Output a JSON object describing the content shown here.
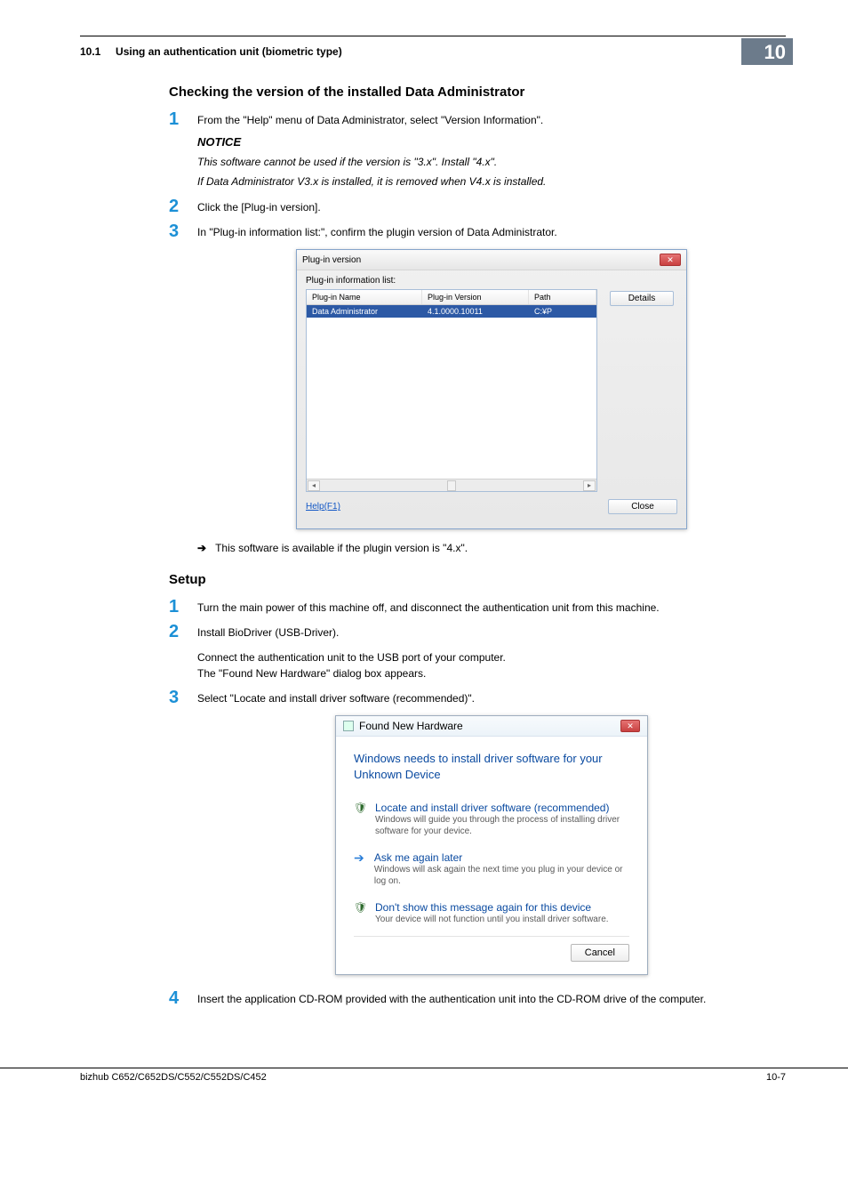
{
  "header": {
    "section_number": "10.1",
    "section_title": "Using an authentication unit (biometric type)",
    "chapter_number": "10"
  },
  "section_a": {
    "title": "Checking the version of the installed Data Administrator",
    "steps": {
      "s1": {
        "text": "From the \"Help\" menu of Data Administrator, select \"Version Information\".",
        "notice_label": "NOTICE",
        "notice_line1": "This software cannot be used if the version is \"3.x\". Install \"4.x\".",
        "notice_line2": "If Data Administrator V3.x is installed, it is removed when V4.x is installed."
      },
      "s2": {
        "text": "Click the [Plug-in version]."
      },
      "s3": {
        "text": "In \"Plug-in information list:\", confirm the plugin version of Data Administrator."
      }
    },
    "plugin_dialog": {
      "title": "Plug-in version",
      "list_label": "Plug-in information list:",
      "columns": {
        "name": "Plug-in Name",
        "version": "Plug-in Version",
        "path": "Path"
      },
      "row": {
        "name": "Data Administrator",
        "version": "4.1.0000.10011",
        "path": "C:¥P"
      },
      "details_button": "Details",
      "help_link": "Help(F1)",
      "close_button": "Close"
    },
    "note_arrow": "This software is available if the plugin version is \"4.x\"."
  },
  "section_b": {
    "title": "Setup",
    "steps": {
      "s1": {
        "text": "Turn the main power of this machine off, and disconnect the authentication unit from this machine."
      },
      "s2": {
        "text": "Install BioDriver (USB-Driver).",
        "extra1": "Connect the authentication unit to the USB port of your computer.",
        "extra2": "The \"Found New Hardware\" dialog box appears."
      },
      "s3": {
        "text": "Select \"Locate and install driver software (recommended)\"."
      },
      "s4": {
        "text": "Insert the application CD-ROM provided with the authentication unit into the CD-ROM drive of the computer."
      }
    },
    "fnh_dialog": {
      "title": "Found New Hardware",
      "heading": "Windows needs to install driver software for your Unknown Device",
      "opt1": {
        "title": "Locate and install driver software (recommended)",
        "desc": "Windows will guide you through the process of installing driver software for your device."
      },
      "opt2": {
        "title": "Ask me again later",
        "desc": "Windows will ask again the next time you plug in your device or log on."
      },
      "opt3": {
        "title": "Don't show this message again for this device",
        "desc": "Your device will not function until you install driver software."
      },
      "cancel": "Cancel"
    }
  },
  "footer": {
    "model": "bizhub C652/C652DS/C552/C552DS/C452",
    "page": "10-7"
  }
}
